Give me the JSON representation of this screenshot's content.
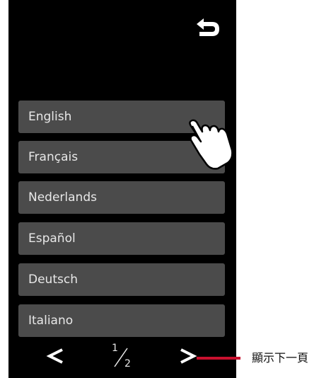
{
  "languages": [
    {
      "label": "English"
    },
    {
      "label": "Français"
    },
    {
      "label": "Nederlands"
    },
    {
      "label": "Español"
    },
    {
      "label": "Deutsch"
    },
    {
      "label": "Italiano"
    }
  ],
  "pager": {
    "current": "1",
    "total": "2",
    "prev_icon": "chevron-left-icon",
    "next_icon": "chevron-right-icon"
  },
  "back_icon": "back-arrow-icon",
  "annotation": {
    "text": "顯示下一頁",
    "line_color": "#c8102e"
  },
  "colors": {
    "screen_bg": "#000000",
    "item_bg": "#4b4b4b",
    "item_text": "#e8e8e8"
  }
}
